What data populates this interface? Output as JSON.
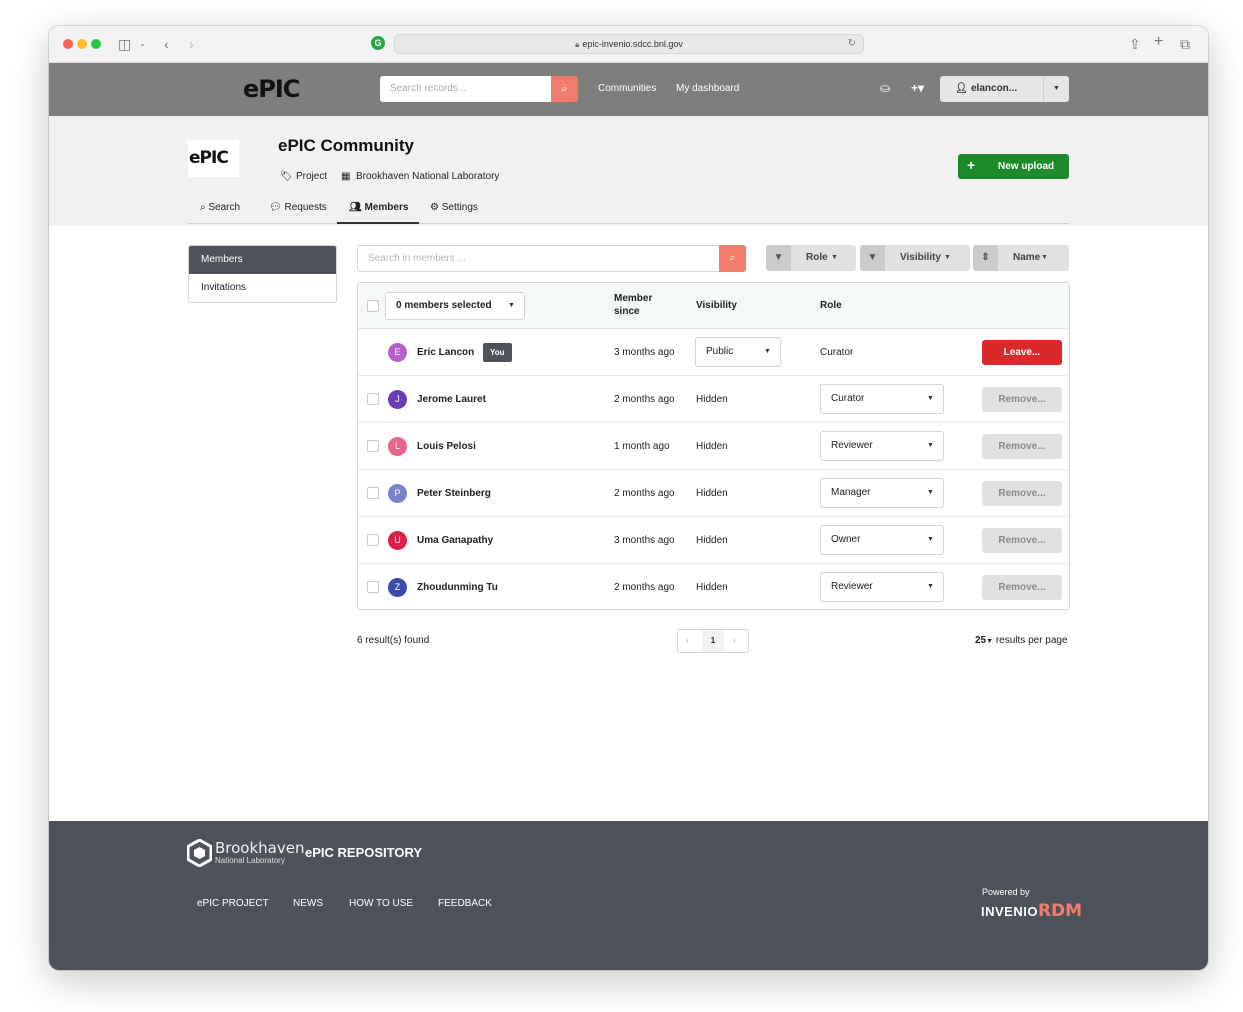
{
  "browser": {
    "url": "epic-invenio.sdcc.bnl.gov"
  },
  "header": {
    "logo_text": "ePIC",
    "search_placeholder": "Search records...",
    "nav": [
      "Communities",
      "My dashboard"
    ],
    "user": "elancon..."
  },
  "community": {
    "logo_text": "ePIC",
    "title": "ePIC Community",
    "type": "Project",
    "organization": "Brookhaven National Laboratory",
    "new_upload": "New upload",
    "tabs": [
      "Search",
      "Requests",
      "Members",
      "Settings"
    ],
    "active_tab": "Members"
  },
  "sidebar": {
    "items": [
      "Members",
      "Invitations"
    ]
  },
  "members": {
    "search_placeholder": "Search in members ...",
    "filters": [
      "Role",
      "Visibility",
      "Name"
    ],
    "bulk_select": "0 members selected",
    "columns": {
      "since": "Member since",
      "visibility": "Visibility",
      "role": "Role"
    },
    "rows": [
      {
        "initial": "E",
        "name": "Eric Lancon",
        "badge": "You",
        "since": "3 months ago",
        "visibility": "Public",
        "role": "Curator",
        "action": "Leave...",
        "color": "#b460c8"
      },
      {
        "initial": "J",
        "name": "Jerome Lauret",
        "since": "2 months ago",
        "visibility": "Hidden",
        "role": "Curator",
        "action": "Remove...",
        "color": "#6a3db5"
      },
      {
        "initial": "L",
        "name": "Louis Pelosi",
        "since": "1 month ago",
        "visibility": "Hidden",
        "role": "Reviewer",
        "action": "Remove...",
        "color": "#e8648a"
      },
      {
        "initial": "P",
        "name": "Peter Steinberg",
        "since": "2 months ago",
        "visibility": "Hidden",
        "role": "Manager",
        "action": "Remove...",
        "color": "#7a82c8"
      },
      {
        "initial": "U",
        "name": "Uma Ganapathy",
        "since": "3 months ago",
        "visibility": "Hidden",
        "role": "Owner",
        "action": "Remove...",
        "color": "#dc1f4a"
      },
      {
        "initial": "Z",
        "name": "Zhoudunming Tu",
        "since": "2 months ago",
        "visibility": "Hidden",
        "role": "Reviewer",
        "action": "Remove...",
        "color": "#3b4ba8"
      }
    ],
    "results": "6 result(s) found",
    "page": "1",
    "per_page_value": "25",
    "per_page_label": "results per page"
  },
  "footer": {
    "org_name": "Brookhaven",
    "org_sub": "National Laboratory",
    "repo_title": "ePIC REPOSITORY",
    "links": [
      "ePIC PROJECT",
      "NEWS",
      "HOW TO USE",
      "FEEDBACK"
    ],
    "powered_by": "Powered by",
    "invenio": "INVENIO",
    "rdm": "RDM"
  },
  "colors": {
    "accent": "#f27c6c",
    "primary_green": "#1e8a2c",
    "danger": "#db2828",
    "nav_bg": "#7d7f7d",
    "footer_bg": "#4d525b"
  }
}
